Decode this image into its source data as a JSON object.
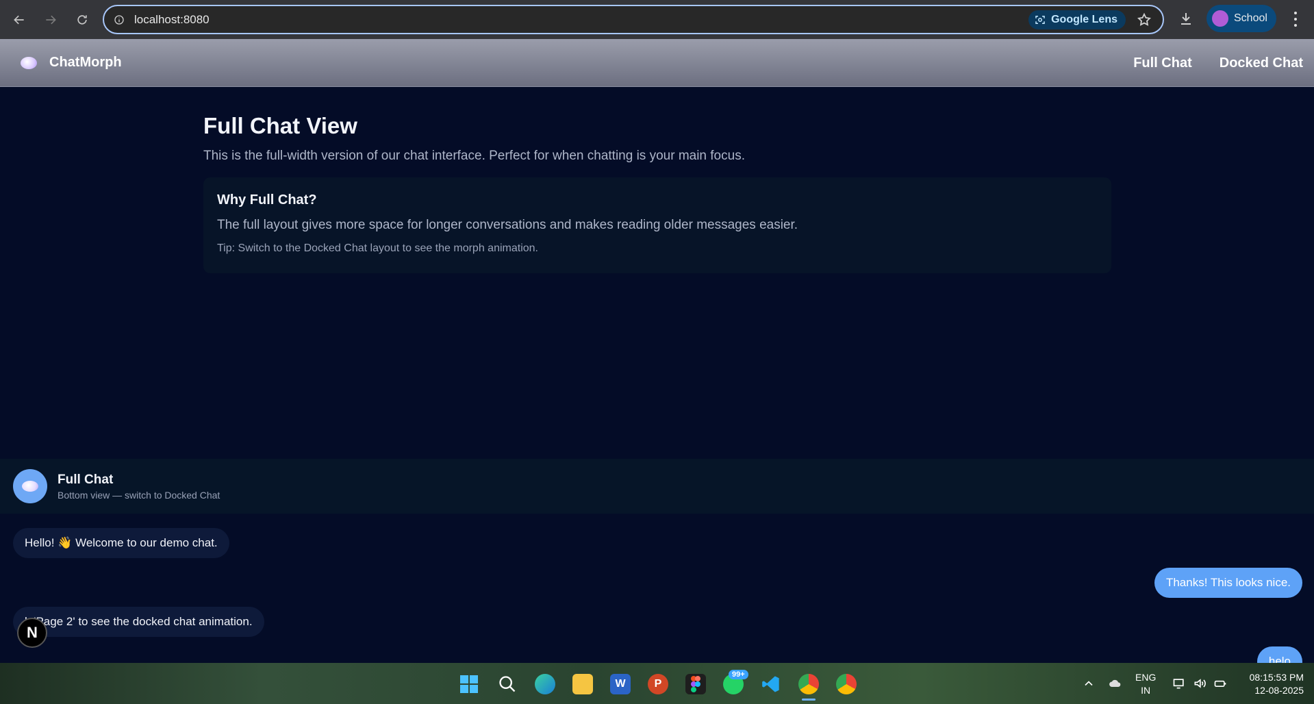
{
  "browser": {
    "url": "localhost:8080",
    "lens_label": "Google Lens",
    "profile_label": "School"
  },
  "app": {
    "brand": "ChatMorph",
    "nav": [
      "Full Chat",
      "Docked Chat"
    ]
  },
  "main": {
    "title": "Full Chat View",
    "subtitle": "This is the full-width version of our chat interface. Perfect for when chatting is your main focus.",
    "card": {
      "title": "Why Full Chat?",
      "text": "The full layout gives more space for longer conversations and makes reading older messages easier.",
      "tip": "Tip: Switch to the Docked Chat layout to see the morph animation."
    }
  },
  "chat": {
    "title": "Full Chat",
    "subtitle": "Bottom view — switch to Docked Chat",
    "messages": [
      {
        "side": "in",
        "text": "Hello! 👋 Welcome to our demo chat."
      },
      {
        "side": "out",
        "text": "Thanks! This looks nice."
      },
      {
        "side": "in",
        "text": "k 'Page 2' to see the docked chat animation."
      },
      {
        "side": "out",
        "text": "helo"
      }
    ],
    "badge_letter": "N"
  },
  "taskbar": {
    "whatsapp_badge": "99+",
    "lang_line1": "ENG",
    "lang_line2": "IN",
    "time": "08:15:53 PM",
    "date": "12-08-2025"
  },
  "colors": {
    "page_bg": "#040c27",
    "user_bubble": "#5ea2f7",
    "bot_bubble": "#0e1a3a"
  }
}
